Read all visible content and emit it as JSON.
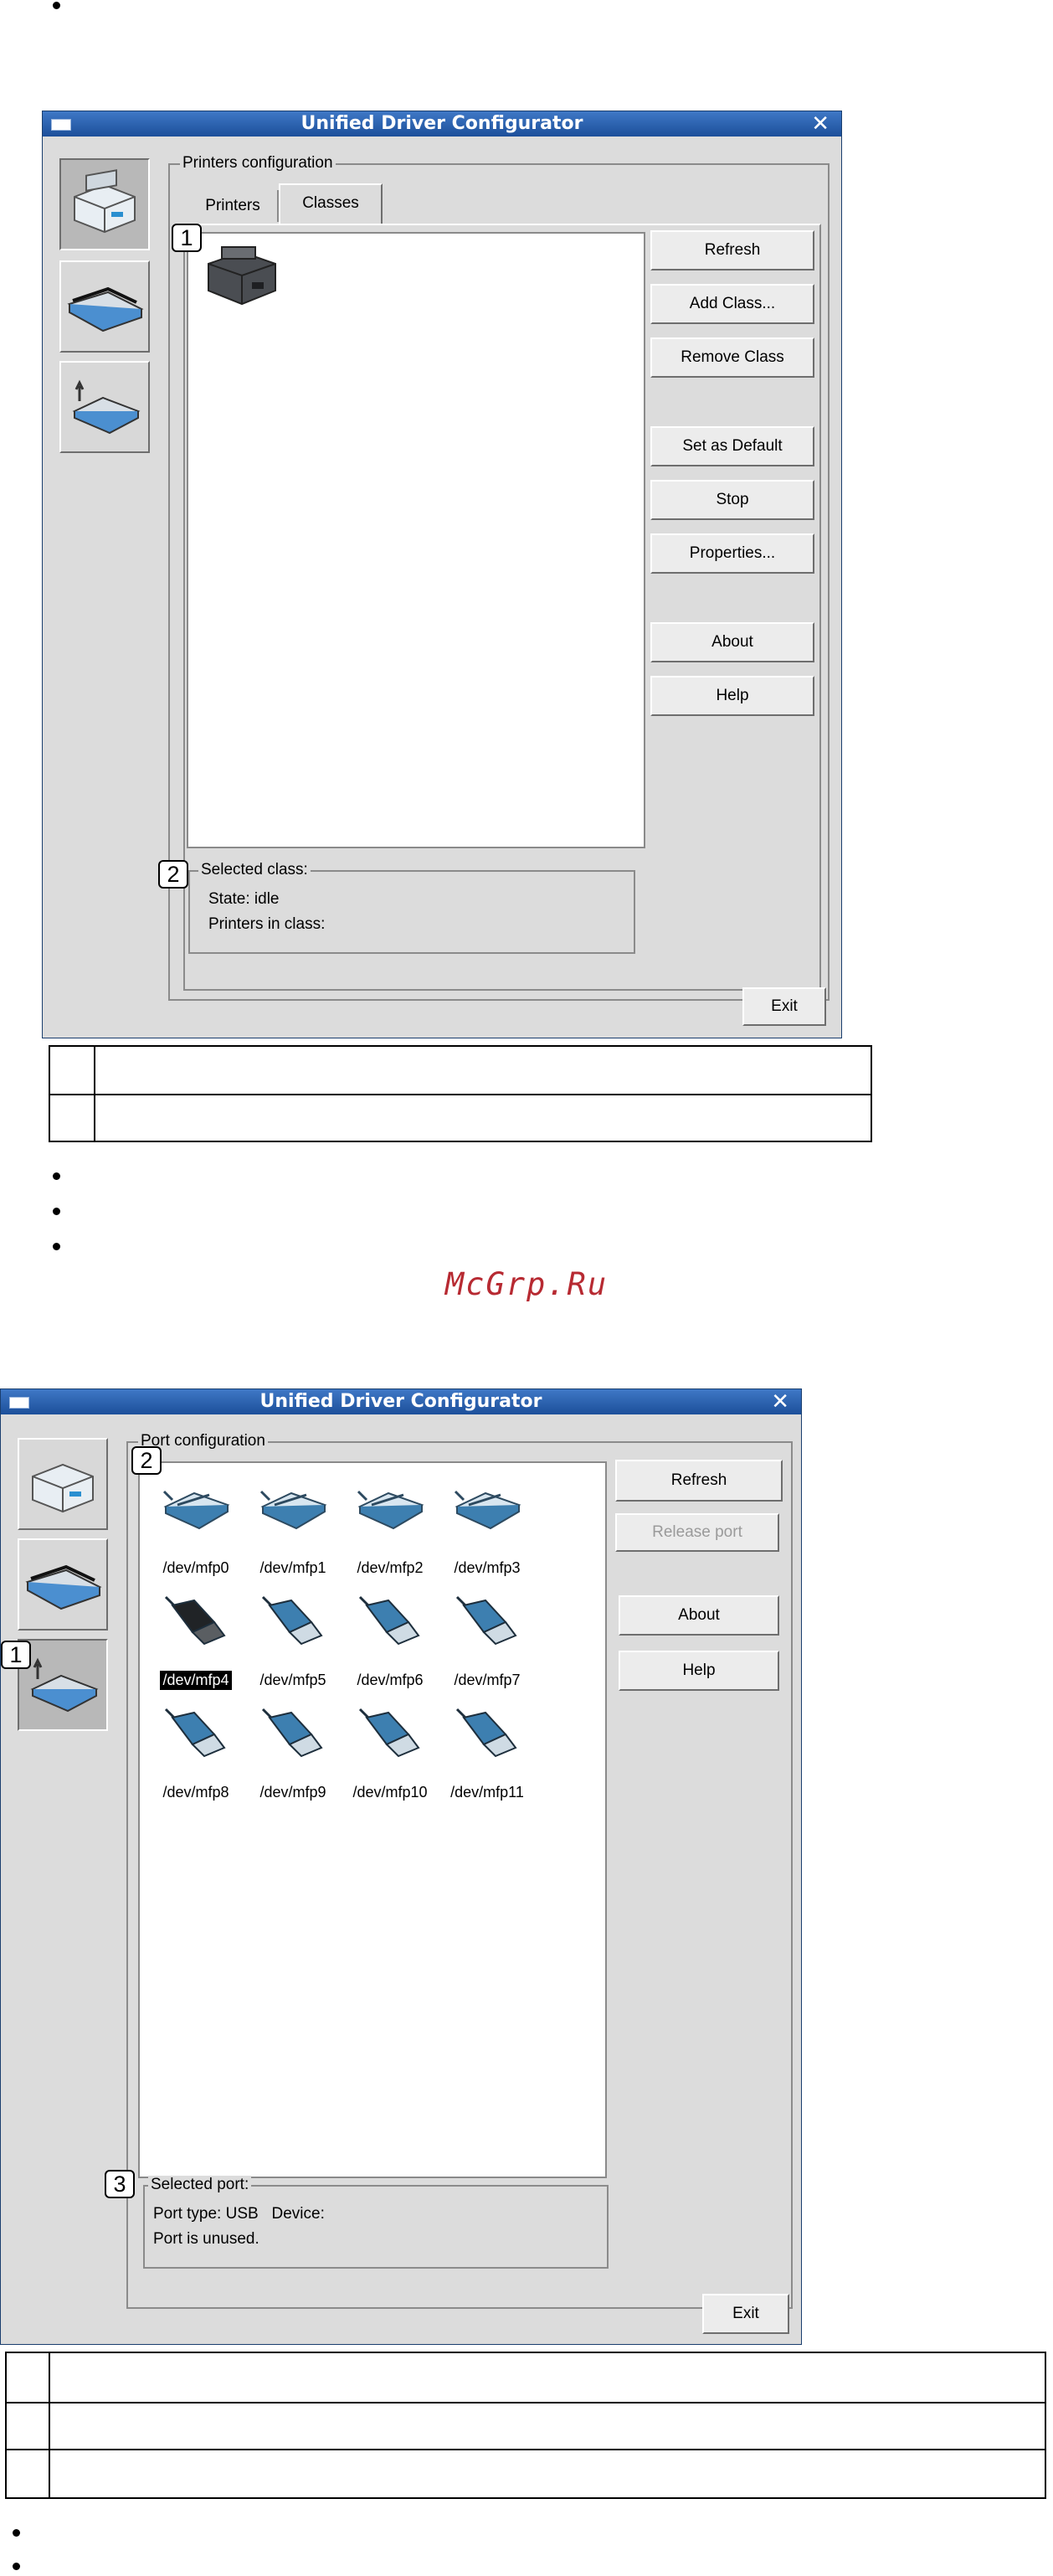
{
  "app": {
    "window_title": "Unified Driver Configurator"
  },
  "classes_window": {
    "group_title": "Printers configuration",
    "tabs": [
      "Printers",
      "Classes"
    ],
    "active_tab": "Classes",
    "side_icons": [
      "printer-icon",
      "scanner-icon",
      "port-icon"
    ],
    "active_side": "printer-icon",
    "buttons": {
      "refresh": "Refresh",
      "add_class": "Add Class...",
      "remove_class": "Remove Class",
      "set_default": "Set as Default",
      "stop": "Stop",
      "properties": "Properties...",
      "about": "About",
      "help": "Help",
      "exit": "Exit"
    },
    "selected_group_title": "Selected class:",
    "state_line": "State: idle",
    "printers_line": "Printers in class:",
    "callouts": [
      "1",
      "2"
    ]
  },
  "ports_window": {
    "group_title": "Port configuration",
    "ports": [
      {
        "label": "/dev/mfp0",
        "kind": "parallel"
      },
      {
        "label": "/dev/mfp1",
        "kind": "parallel"
      },
      {
        "label": "/dev/mfp2",
        "kind": "parallel"
      },
      {
        "label": "/dev/mfp3",
        "kind": "parallel"
      },
      {
        "label": "/dev/mfp4",
        "kind": "usb",
        "selected": true
      },
      {
        "label": "/dev/mfp5",
        "kind": "usb"
      },
      {
        "label": "/dev/mfp6",
        "kind": "usb"
      },
      {
        "label": "/dev/mfp7",
        "kind": "usb"
      },
      {
        "label": "/dev/mfp8",
        "kind": "usb"
      },
      {
        "label": "/dev/mfp9",
        "kind": "usb"
      },
      {
        "label": "/dev/mfp10",
        "kind": "usb"
      },
      {
        "label": "/dev/mfp11",
        "kind": "usb"
      }
    ],
    "buttons": {
      "refresh": "Refresh",
      "release_port": "Release port",
      "about": "About",
      "help": "Help",
      "exit": "Exit"
    },
    "selected_group_title": "Selected port:",
    "port_type_line": "Port type: USB   Device:",
    "port_status_line": "Port is unused.",
    "callouts": [
      "1",
      "2",
      "3"
    ]
  },
  "watermark": "McGrp.Ru",
  "colors": {
    "titlebar": "#2a5fae",
    "window_bg": "#dcdcdc",
    "watermark": "#b72a32",
    "usb_icon": "#3d7fb0"
  }
}
